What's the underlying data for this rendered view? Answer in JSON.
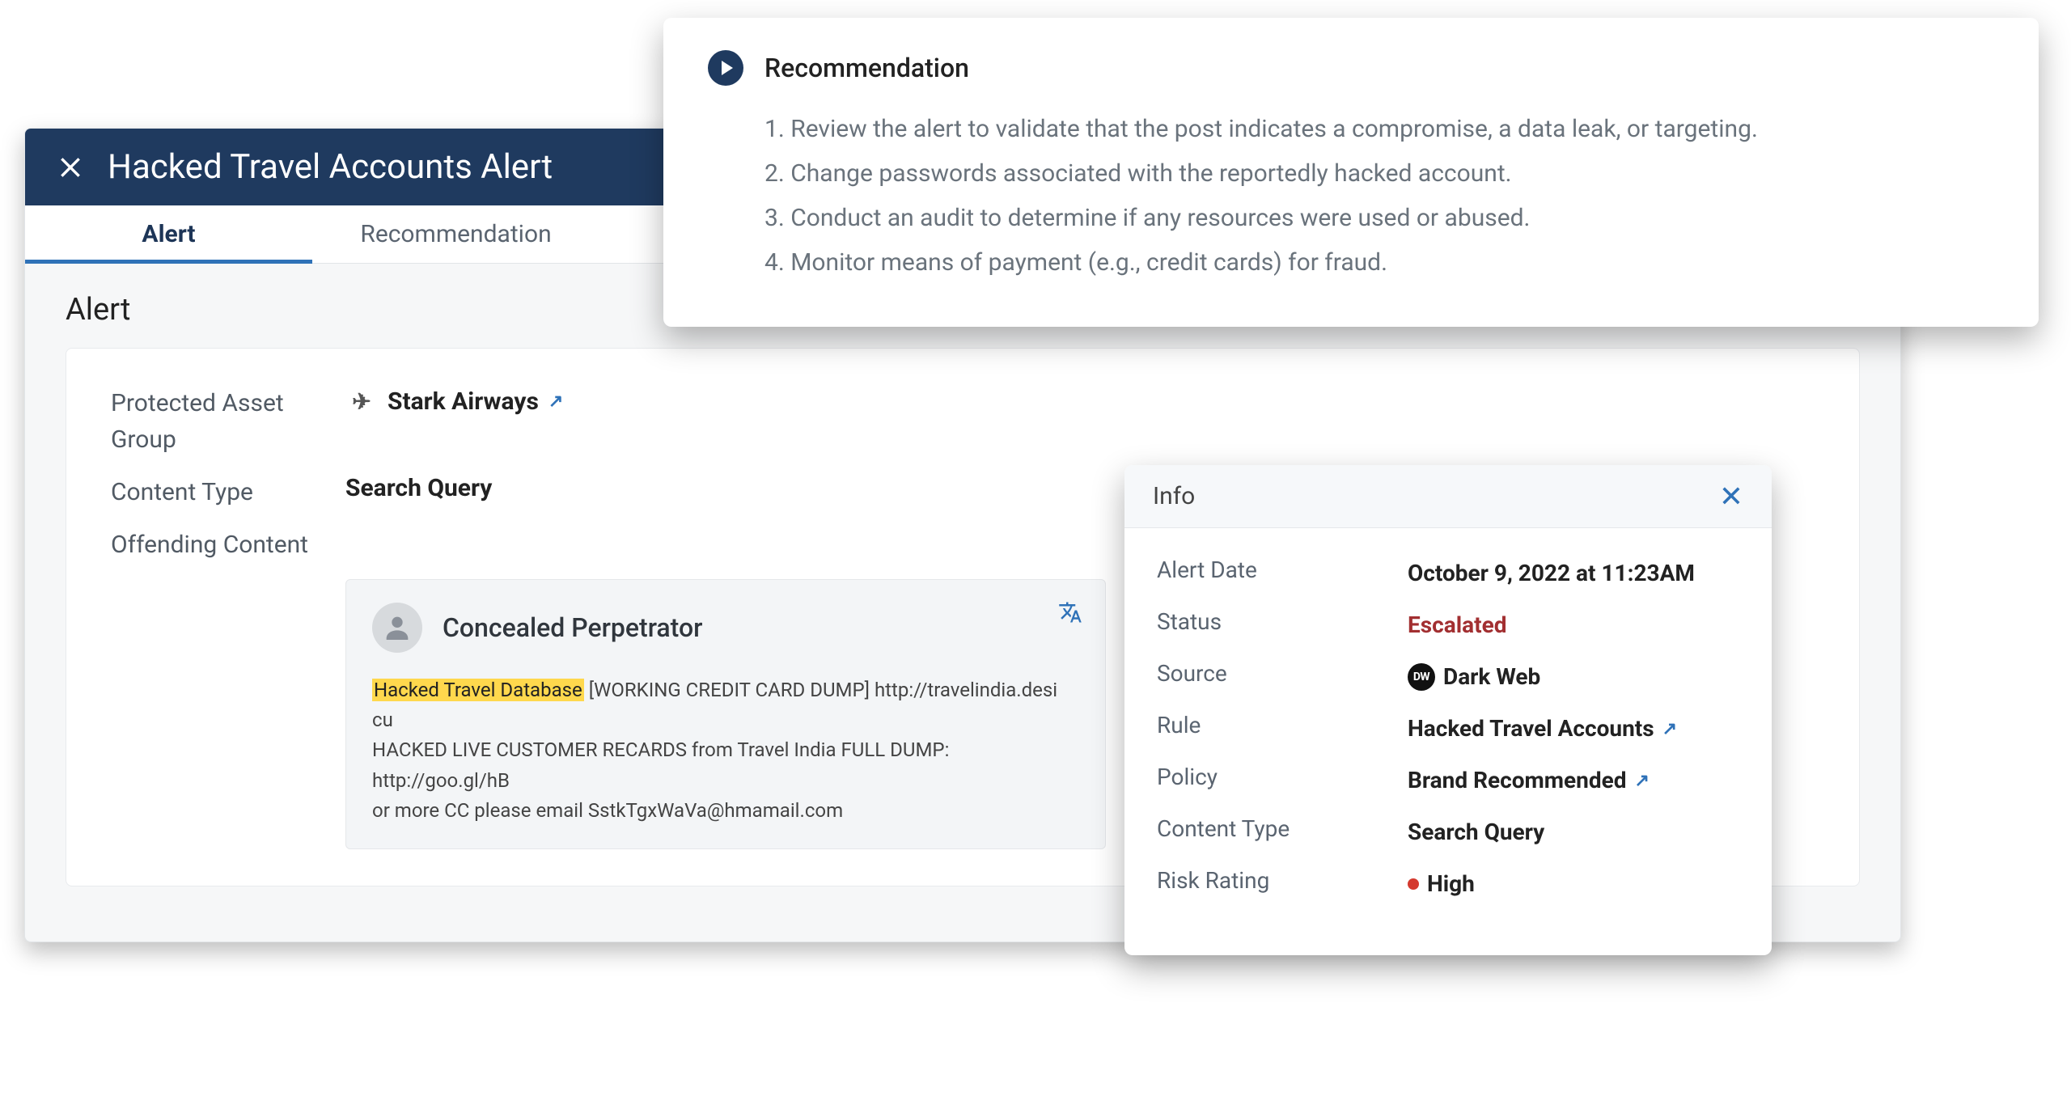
{
  "alert": {
    "title": "Hacked Travel Accounts Alert",
    "tabs": {
      "alert": "Alert",
      "recommendation": "Recommendation"
    },
    "section_title": "Alert",
    "fields": {
      "protected_asset_group_label": "Protected Asset Group",
      "protected_asset_group_value": "Stark Airways",
      "content_type_label": "Content Type",
      "content_type_value": "Search Query",
      "offending_content_label": "Offending Content"
    },
    "offending": {
      "perpetrator": "Concealed Perpetrator",
      "highlight": "Hacked Travel Database",
      "text_after_hl": " [WORKING CREDIT CARD DUMP] http://travelindia.desi cu",
      "line2": "HACKED LIVE CUSTOMER RECARDS from Travel India FULL DUMP: http://goo.gl/hB",
      "line3": "or more CC please email SstkTgxWaVa@hmamail.com"
    }
  },
  "recommendation": {
    "title": "Recommendation",
    "steps": [
      "Review the alert to validate that the post indicates a compromise, a data leak, or targeting.",
      "Change passwords associated with the reportedly hacked account.",
      "Conduct an audit to determine if any resources were used or abused.",
      "Monitor means of payment (e.g., credit cards) for fraud."
    ]
  },
  "info": {
    "title": "Info",
    "rows": {
      "alert_date_label": "Alert Date",
      "alert_date_value": "October 9, 2022 at 11:23AM",
      "status_label": "Status",
      "status_value": "Escalated",
      "source_label": "Source",
      "source_badge": "DW",
      "source_value": "Dark Web",
      "rule_label": "Rule",
      "rule_value": "Hacked Travel Accounts",
      "policy_label": "Policy",
      "policy_value": "Brand Recommended",
      "content_type_label": "Content Type",
      "content_type_value": "Search Query",
      "risk_rating_label": "Risk Rating",
      "risk_rating_value": "High"
    }
  }
}
